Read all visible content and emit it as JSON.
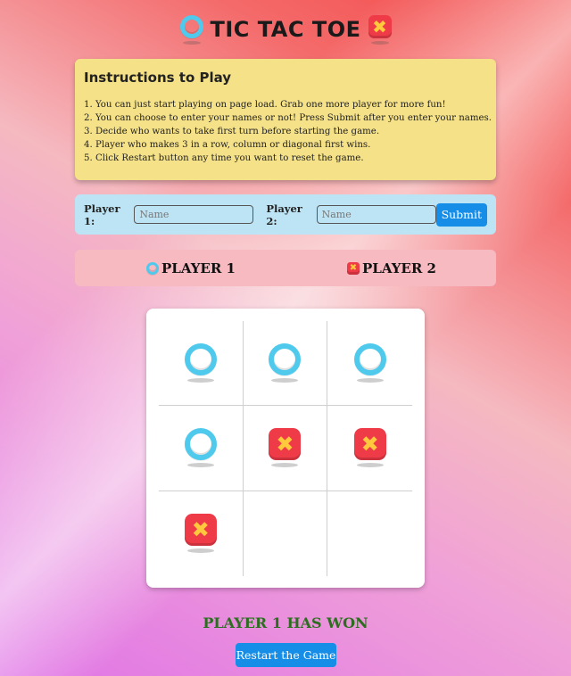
{
  "title": "TIC TAC TOE",
  "icons": {
    "o": "blue-ring-icon",
    "x": "red-x-icon"
  },
  "colors": {
    "o_ring": "#4fc9ec",
    "x_box": "#ef3b48",
    "x_mark": "#ffc83d",
    "button": "#168de6",
    "win_text": "#2c6e1f"
  },
  "instructions": {
    "heading": "Instructions to Play",
    "items": [
      "1. You can just start playing on page load. Grab one more player for more fun!",
      "2. You can choose to enter your names or not! Press Submit after you enter your names.",
      "3. Decide who wants to take first turn before starting the game.",
      "4. Player who makes 3 in a row, column or diagonal first wins.",
      "5. Click Restart button any time you want to reset the game."
    ]
  },
  "form": {
    "player1_label": "Player 1:",
    "player1_placeholder": "Name",
    "player1_value": "",
    "player2_label": "Player 2:",
    "player2_placeholder": "Name",
    "player2_value": "",
    "submit_label": "Submit"
  },
  "scoreboard": {
    "player1": "PLAYER 1",
    "player2": "PLAYER 2"
  },
  "board": {
    "cells": [
      "O",
      "O",
      "O",
      "O",
      "X",
      "X",
      "X",
      "",
      ""
    ]
  },
  "status": "PLAYER 1 HAS WON",
  "restart_label": "Restart the Game"
}
